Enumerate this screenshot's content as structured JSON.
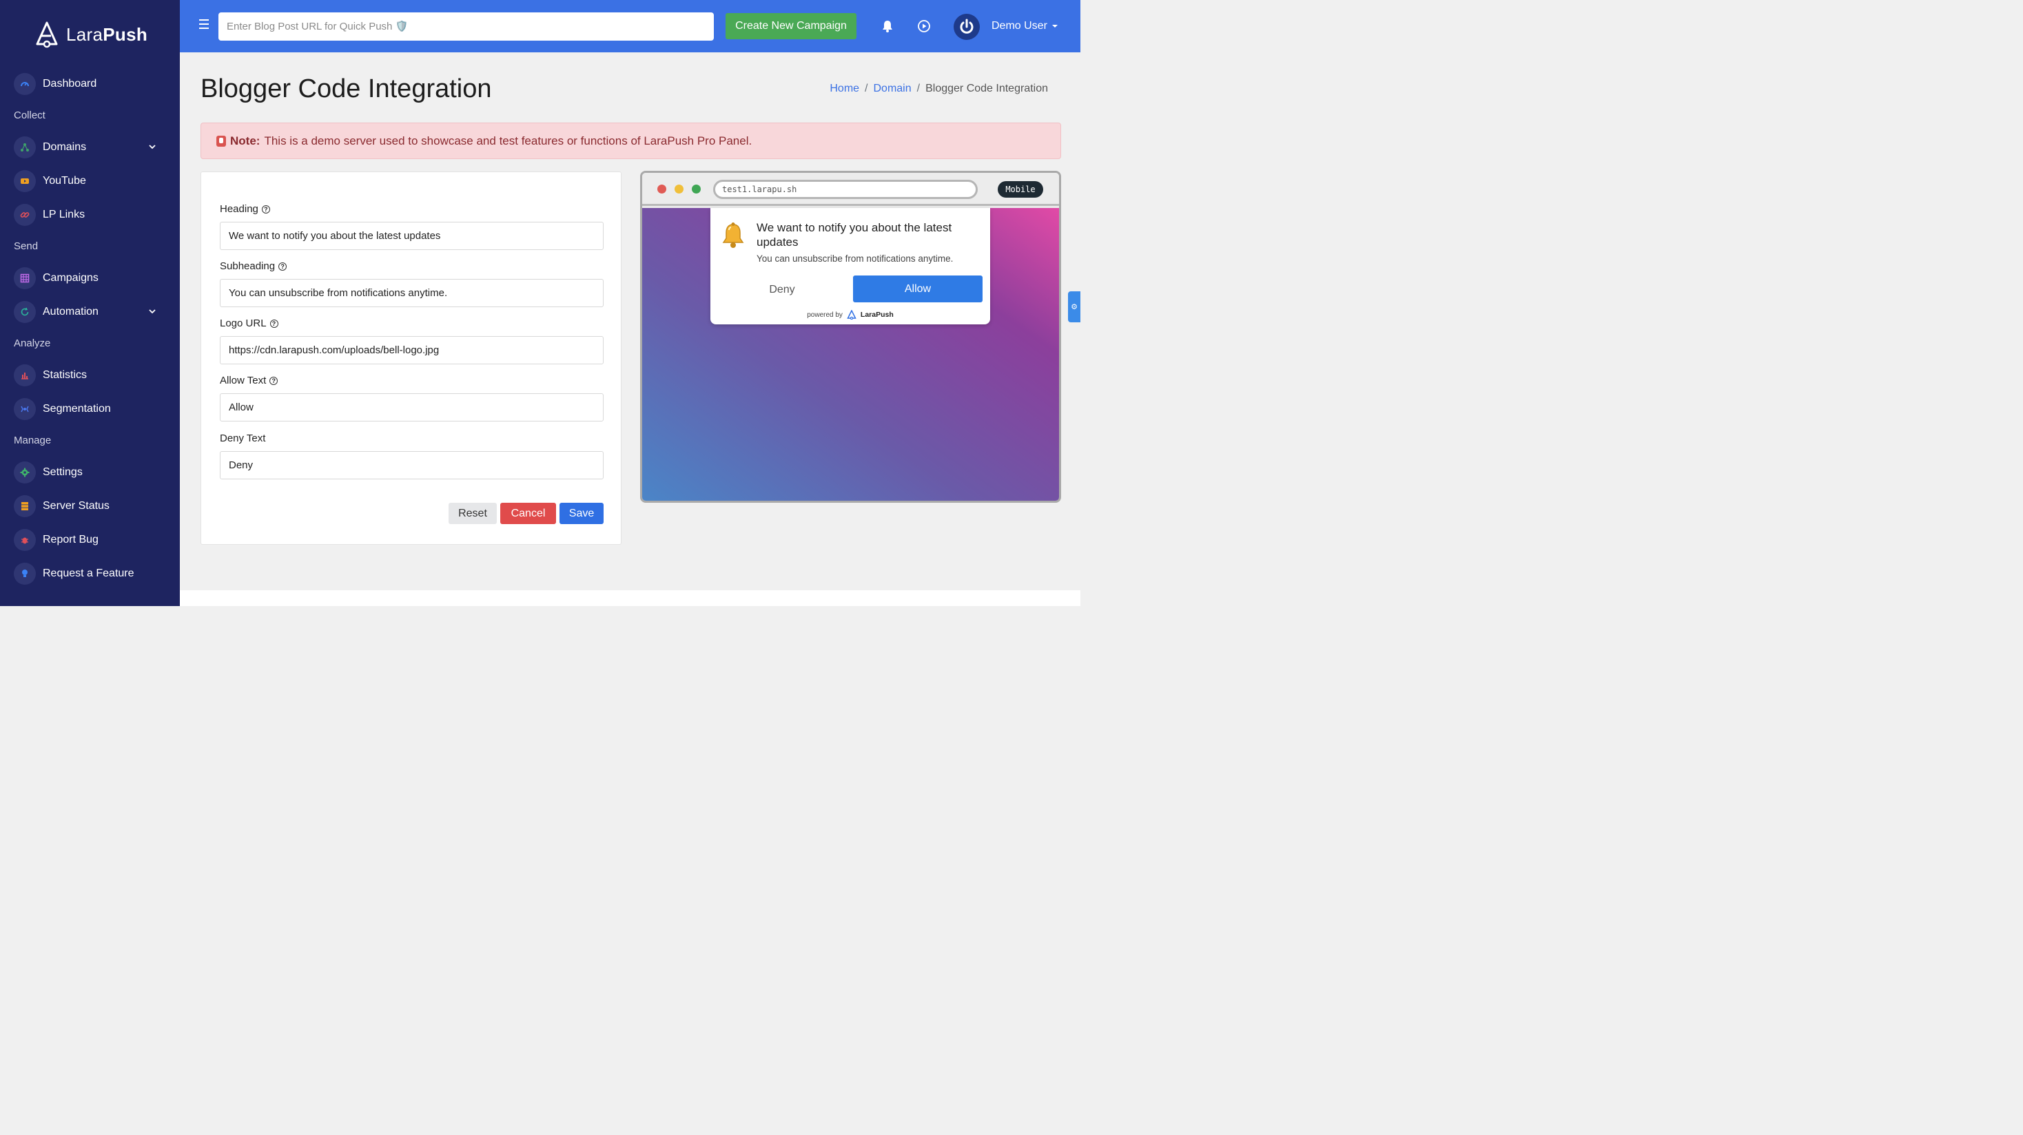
{
  "brand": {
    "name_light": "Lara",
    "name_bold": "Push"
  },
  "sidebar": {
    "items": [
      {
        "label": "Dashboard",
        "icon": "gauge-icon"
      },
      {
        "label": "Domains",
        "icon": "network-icon"
      },
      {
        "label": "YouTube",
        "icon": "youtube-icon"
      },
      {
        "label": "LP Links",
        "icon": "link-icon"
      },
      {
        "label": "Campaigns",
        "icon": "grid-icon"
      },
      {
        "label": "Automation",
        "icon": "cycle-icon"
      },
      {
        "label": "Statistics",
        "icon": "bar-chart-icon"
      },
      {
        "label": "Segmentation",
        "icon": "segment-icon"
      },
      {
        "label": "Settings",
        "icon": "gear-icon"
      },
      {
        "label": "Server Status",
        "icon": "server-icon"
      },
      {
        "label": "Report Bug",
        "icon": "bug-icon"
      },
      {
        "label": "Request a Feature",
        "icon": "lightbulb-icon"
      }
    ],
    "sections": [
      "Collect",
      "Send",
      "Analyze",
      "Manage"
    ]
  },
  "topbar": {
    "quick_push_placeholder": "Enter Blog Post URL for Quick Push 🛡️",
    "create_campaign": "Create New Campaign",
    "user_name": "Demo User"
  },
  "page": {
    "title": "Blogger Code Integration",
    "breadcrumb": [
      "Home",
      "Domain",
      "Blogger Code Integration"
    ]
  },
  "alert": {
    "label": "Note:",
    "text": "This is a demo server used to showcase and test features or functions of LaraPush Pro Panel."
  },
  "form": {
    "heading_label": "Heading",
    "heading_value": "We want to notify you about the latest updates",
    "subheading_label": "Subheading",
    "subheading_value": "You can unsubscribe from notifications anytime.",
    "logo_label": "Logo URL",
    "logo_value": "https://cdn.larapush.com/uploads/bell-logo.jpg",
    "allow_label": "Allow Text",
    "allow_value": "Allow",
    "deny_label": "Deny Text",
    "deny_value": "Deny",
    "reset": "Reset",
    "cancel": "Cancel",
    "save": "Save"
  },
  "preview": {
    "url": "test1.larapu.sh",
    "mode": "Mobile",
    "title": "We want to notify you about the latest updates",
    "subtitle": "You can unsubscribe from notifications anytime.",
    "deny": "Deny",
    "allow": "Allow",
    "powered_by": "powered by",
    "powered_brand": "LaraPush"
  },
  "colors": {
    "sidebar_bg": "#1e2460",
    "topbar_bg": "#3b71e4",
    "create_btn": "#4aa955",
    "alert_bg": "#f8d7da",
    "save_btn": "#2f6fe3",
    "cancel_btn": "#e04b4b"
  }
}
